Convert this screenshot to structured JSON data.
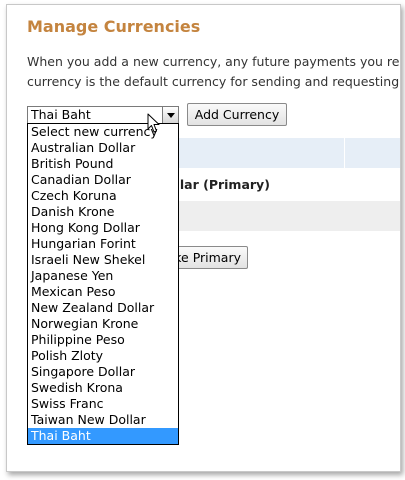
{
  "page": {
    "title": "Manage Currencies",
    "description_line1": "When you add a new currency, any future payments you receive",
    "description_line2": "currency is the default currency for sending and requesting payr"
  },
  "currency_select": {
    "selected_value": "Thai Baht",
    "options": [
      "Select new currency",
      "Australian Dollar",
      "British Pound",
      "Canadian Dollar",
      "Czech Koruna",
      "Danish Krone",
      "Hong Kong Dollar",
      "Hungarian Forint",
      "Israeli New Shekel",
      "Japanese Yen",
      "Mexican Peso",
      "New Zealand Dollar",
      "Norwegian Krone",
      "Philippine Peso",
      "Polish Zloty",
      "Singapore Dollar",
      "Swedish Krona",
      "Swiss Franc",
      "Taiwan New Dollar",
      "Thai Baht"
    ],
    "highlighted_index": 19
  },
  "buttons": {
    "add_currency": "Add Currency",
    "make_primary": "ke Primary"
  },
  "table": {
    "primary_row_text": "ollar (Primary)"
  },
  "colors": {
    "title": "#c4843f",
    "highlight": "#3399ff",
    "table_header": "#e6eef7"
  }
}
